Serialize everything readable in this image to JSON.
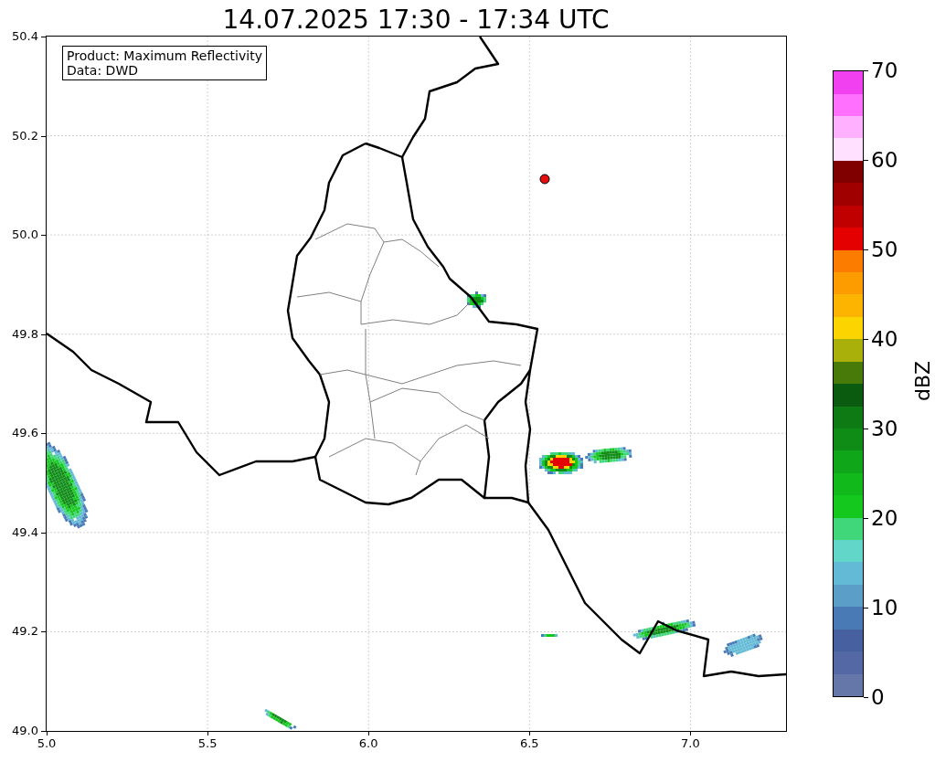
{
  "title": "14.07.2025 17:30 - 17:34 UTC",
  "legend": [
    "Product: Maximum Reflectivity",
    "Data: DWD"
  ],
  "map": {
    "x_ticks": [
      "5.0",
      "5.5",
      "6.0",
      "6.5",
      "7.0"
    ],
    "y_ticks": [
      "50.4",
      "50.2",
      "50.0",
      "49.8",
      "49.6",
      "49.4",
      "49.2",
      "49.0"
    ]
  },
  "colorbar": {
    "label": "dBZ",
    "ticks": [
      "70",
      "60",
      "50",
      "40",
      "30",
      "20",
      "10",
      "0"
    ],
    "segments": [
      {
        "color": "#6576a8"
      },
      {
        "color": "#5468a6"
      },
      {
        "color": "#4660a0"
      },
      {
        "color": "#4a7ab5"
      },
      {
        "color": "#5b9ec8"
      },
      {
        "color": "#62bad6"
      },
      {
        "color": "#62d6c8"
      },
      {
        "color": "#40d67a"
      },
      {
        "color": "#14c81e"
      },
      {
        "color": "#12b91a"
      },
      {
        "color": "#10a619"
      },
      {
        "color": "#0e8c16"
      },
      {
        "color": "#0e7a14"
      },
      {
        "color": "#0a5a10"
      },
      {
        "color": "#487a0a"
      },
      {
        "color": "#aab00a"
      },
      {
        "color": "#fcd400"
      },
      {
        "color": "#fcb400"
      },
      {
        "color": "#fc9c00"
      },
      {
        "color": "#fc7c00"
      },
      {
        "color": "#e40000"
      },
      {
        "color": "#c00000"
      },
      {
        "color": "#a00000"
      },
      {
        "color": "#800000"
      },
      {
        "color": "#ffe0ff"
      },
      {
        "color": "#ffb0ff"
      },
      {
        "color": "#ff70ff"
      },
      {
        "color": "#f040f0"
      }
    ]
  }
}
